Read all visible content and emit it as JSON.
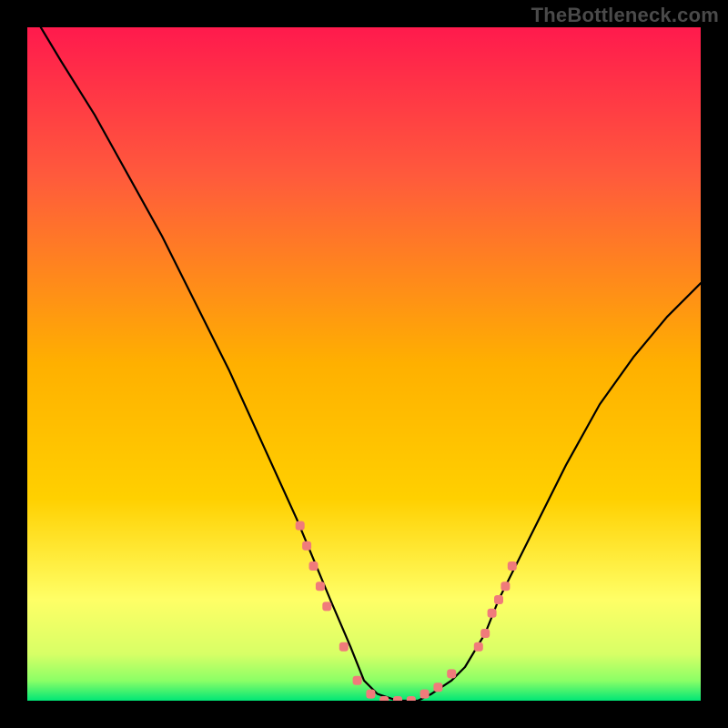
{
  "watermark": "TheBottleneck.com",
  "colors": {
    "frame": "#000000",
    "curve": "#000000",
    "dots": "#f07b7b",
    "gradient_top": "#ff1a4d",
    "gradient_mid": "#ffd000",
    "gradient_low_yellow": "#ffff66",
    "gradient_bottom_green": "#00e676"
  },
  "chart_data": {
    "type": "line",
    "title": "",
    "xlabel": "",
    "ylabel": "",
    "xlim": [
      0,
      100
    ],
    "ylim": [
      0,
      100
    ],
    "series": [
      {
        "name": "curve",
        "x": [
          2,
          5,
          10,
          15,
          20,
          25,
          30,
          35,
          40,
          45,
          48,
          50,
          52,
          55,
          58,
          60,
          63,
          65,
          68,
          70,
          75,
          80,
          85,
          90,
          95,
          100
        ],
        "y": [
          100,
          95,
          87,
          78,
          69,
          59,
          49,
          38,
          27,
          15,
          8,
          3,
          1,
          0,
          0,
          1,
          3,
          5,
          10,
          15,
          25,
          35,
          44,
          51,
          57,
          62
        ]
      }
    ],
    "highlight_dots": {
      "name": "dots",
      "x": [
        40.5,
        41.5,
        42.5,
        43.5,
        44.5,
        47,
        49,
        51,
        53,
        55,
        57,
        59,
        61,
        63,
        67,
        68,
        69,
        70,
        71,
        72
      ],
      "y": [
        26,
        23,
        20,
        17,
        14,
        8,
        3,
        1,
        0,
        0,
        0,
        1,
        2,
        4,
        8,
        10,
        13,
        15,
        17,
        20
      ]
    }
  }
}
